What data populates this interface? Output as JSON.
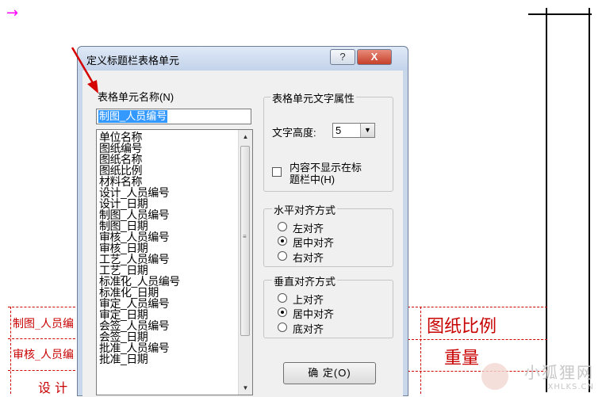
{
  "dialog": {
    "title": "定义标题栏表格单元",
    "help_label": "?",
    "close_label": "X"
  },
  "left": {
    "list_label": "表格单元名称(N)",
    "name_value": "制图_人员编号",
    "items": [
      "单位名称",
      "图纸编号",
      "图纸名称",
      "图纸比例",
      "材料名称",
      "设计_人员编号",
      "设计_日期",
      "制图_人员编号",
      "制图_日期",
      "审核_人员编号",
      "审核_日期",
      "工艺_人员编号",
      "工艺_日期",
      "标准化_人员编号",
      "标准化_日期",
      "审定_人员编号",
      "审定_日期",
      "会签_人员编号",
      "会签_日期",
      "批准_人员编号",
      "批准_日期"
    ]
  },
  "right": {
    "group_text_attr": "表格单元文字属性",
    "text_height_label": "文字高度:",
    "text_height_value": "5",
    "hide_content_line1": "内容不显示在标",
    "hide_content_line2": "题栏中(H)",
    "horizontal_group": "水平对齐方式",
    "h_left": "左对齐",
    "h_center": "居中对齐",
    "h_right": "右对齐",
    "vertical_group": "垂直对齐方式",
    "v_top": "上对齐",
    "v_middle": "居中对齐",
    "v_bottom": "底对齐",
    "ok_label": "确  定(O)"
  },
  "cad": {
    "left_cell_1": "制图_人员编",
    "left_cell_2": "审核_人员编",
    "left_bottom": "设 计",
    "right_cell_1": "图纸比例",
    "right_cell_2": "重量"
  },
  "watermark": {
    "line1": "小狐狸网",
    "line2": "XHLKS.CN"
  },
  "colors": {
    "cad_red": "#c80000",
    "cursor": "#ff00ff",
    "selection": "#3399ff",
    "close_button": "#c6402a"
  }
}
